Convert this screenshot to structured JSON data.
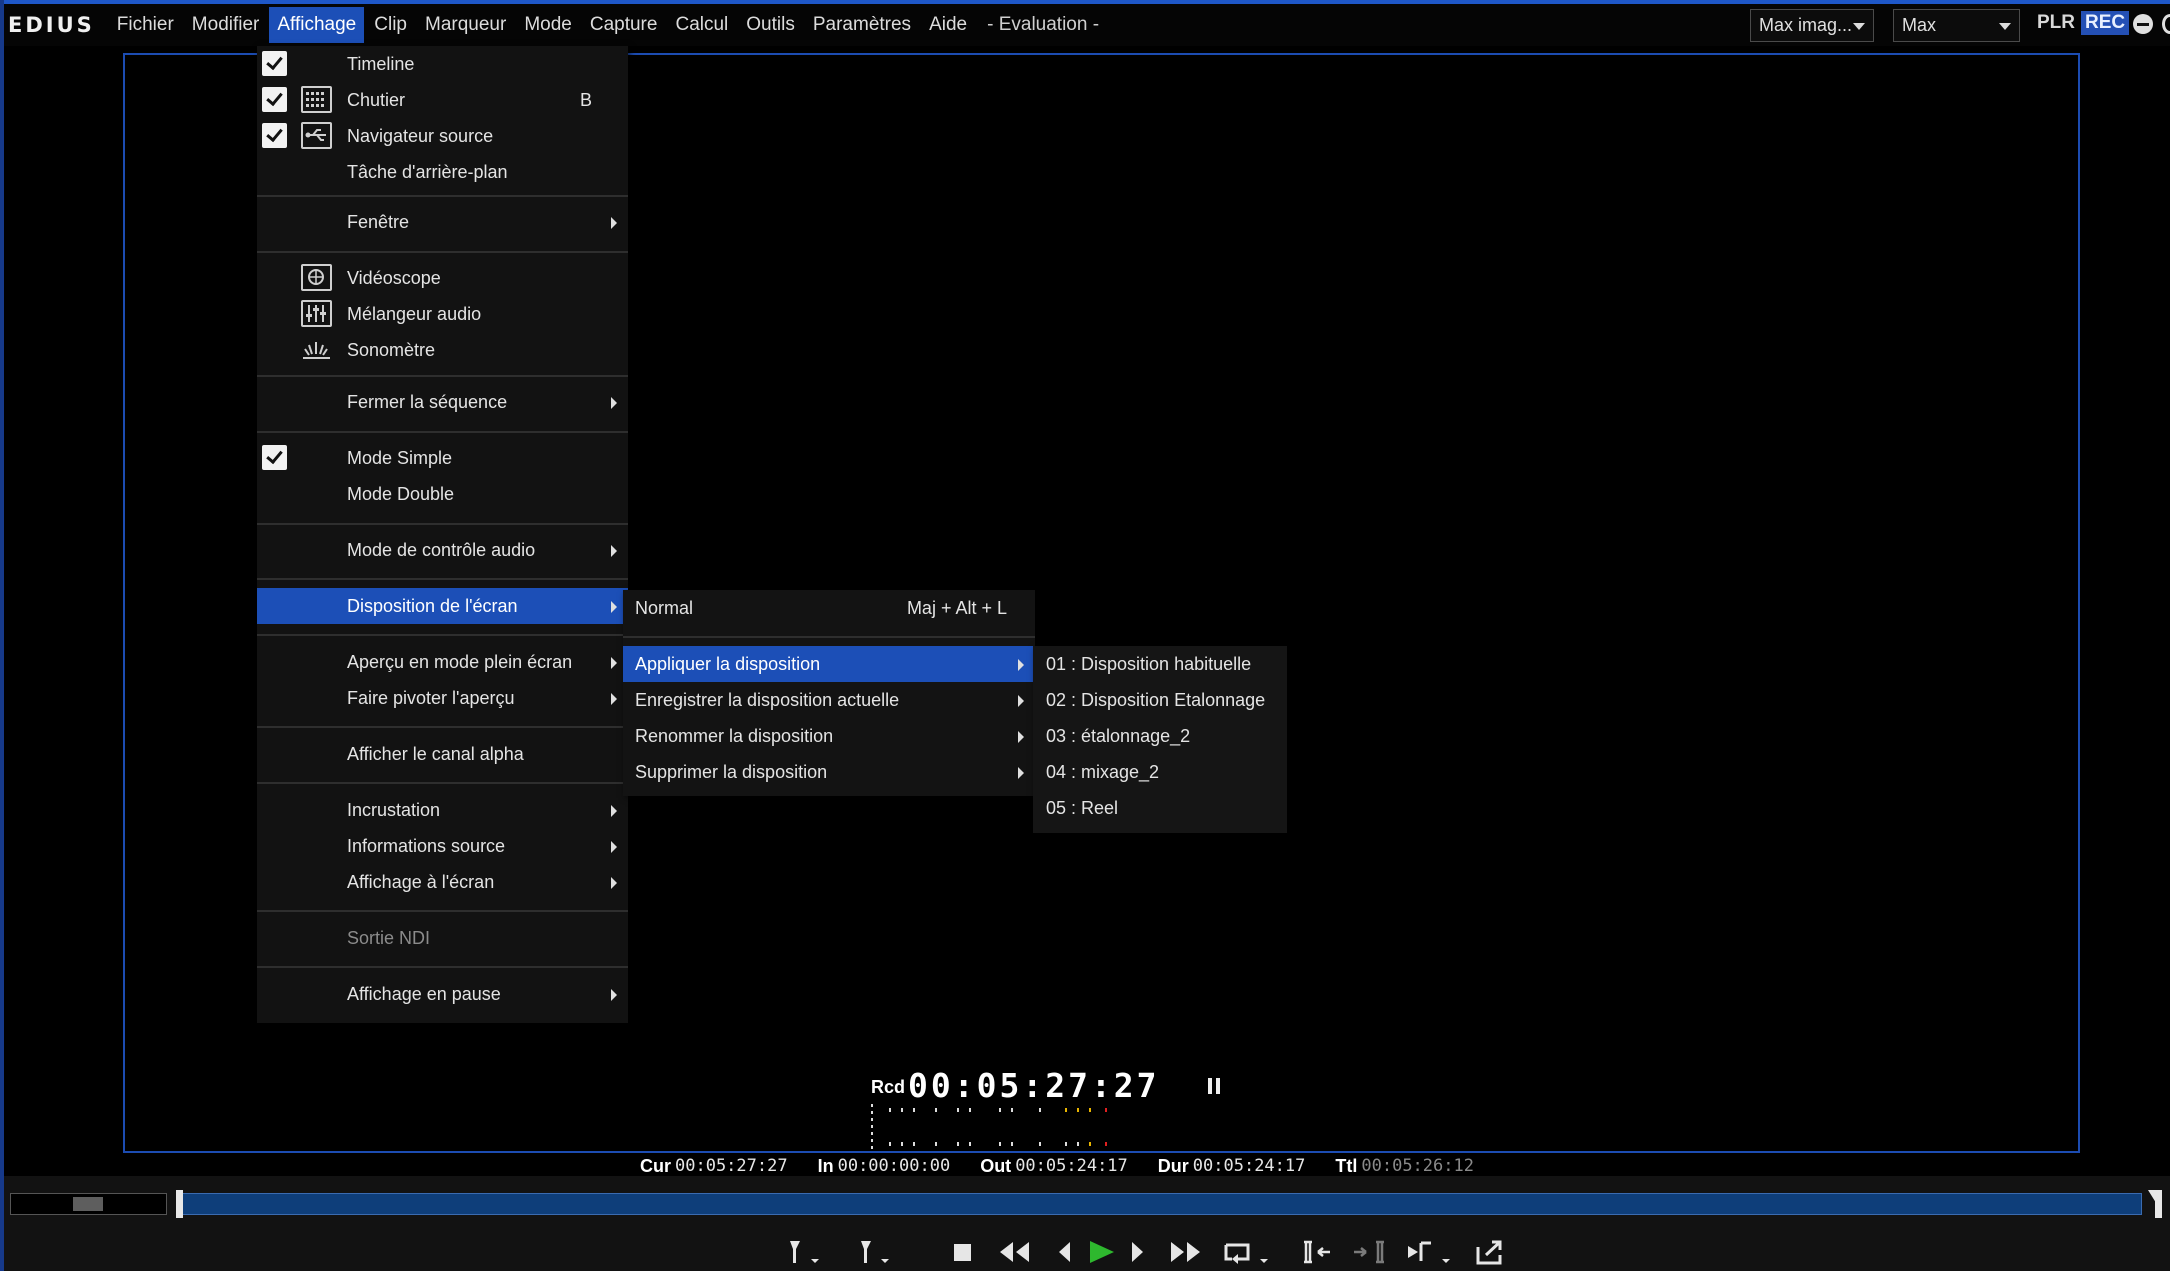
{
  "app": {
    "logo": "EDIUS",
    "menus": [
      "Fichier",
      "Modifier",
      "Affichage",
      "Clip",
      "Marqueur",
      "Mode",
      "Capture",
      "Calcul",
      "Outils",
      "Paramètres",
      "Aide"
    ],
    "active_menu": "Affichage",
    "edition": "- Evaluation -",
    "combo_fit": "Max imag...",
    "combo_zoom": "Max",
    "plr": "PLR",
    "rec": "REC"
  },
  "view_menu": {
    "timeline": "Timeline",
    "chutier": "Chutier",
    "chutier_shortcut": "B",
    "navigateur": "Navigateur source",
    "tache": "Tâche d'arrière-plan",
    "fenetre": "Fenêtre",
    "videoscope": "Vidéoscope",
    "melangeur": "Mélangeur audio",
    "sonometre": "Sonomètre",
    "fermer_seq": "Fermer la séquence",
    "mode_simple": "Mode Simple",
    "mode_double": "Mode Double",
    "mode_audio": "Mode de contrôle audio",
    "disposition": "Disposition de l'écran",
    "apercu_plein": "Aperçu en mode plein écran",
    "pivoter": "Faire pivoter l'aperçu",
    "canal_alpha": "Afficher le canal alpha",
    "incrustation": "Incrustation",
    "info_source": "Informations source",
    "affichage_ecran": "Affichage à l'écran",
    "sortie_ndi": "Sortie NDI",
    "affichage_pause": "Affichage en pause"
  },
  "layout_menu": {
    "normal": "Normal",
    "normal_shortcut": "Maj + Alt + L",
    "appliquer": "Appliquer la disposition",
    "enregistrer": "Enregistrer la disposition actuelle",
    "renommer": "Renommer la disposition",
    "supprimer": "Supprimer la disposition"
  },
  "layouts": [
    "01 : Disposition habituelle",
    "02 : Disposition Etalonnage",
    "03 : étalonnage_2",
    "04 : mixage_2",
    "05 : Reel"
  ],
  "player": {
    "rcd_label": "Rcd",
    "timecode": "00:05:27:27",
    "cur_label": "Cur",
    "cur": "00:05:27:27",
    "in_label": "In",
    "in": "00:00:00:00",
    "out_label": "Out",
    "out": "00:05:24:17",
    "dur_label": "Dur",
    "dur": "00:05:24:17",
    "ttl_label": "Ttl",
    "ttl": "00:05:26:12"
  },
  "colors": {
    "accent": "#1c4fb7",
    "play": "#2eb82e",
    "scrub": "#0e3e7a"
  }
}
